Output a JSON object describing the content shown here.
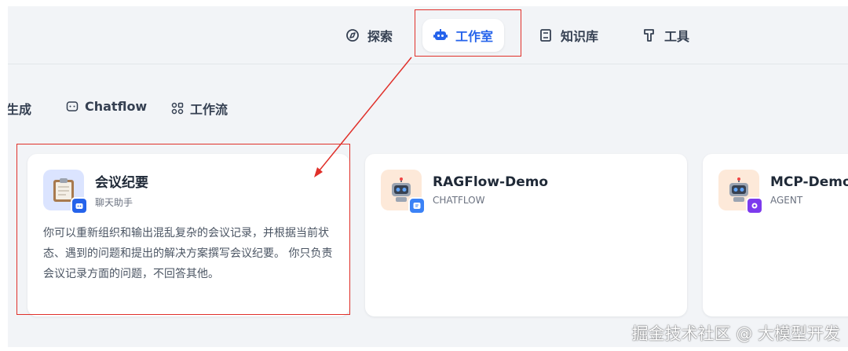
{
  "nav": {
    "items": [
      {
        "label": "探索",
        "icon": "compass-icon",
        "active": false
      },
      {
        "label": "工作室",
        "icon": "robot-icon",
        "active": true
      },
      {
        "label": "知识库",
        "icon": "book-icon",
        "active": false
      },
      {
        "label": "工具",
        "icon": "hammer-icon",
        "active": false
      }
    ]
  },
  "filter_tabs": [
    {
      "label": "生成",
      "icon": "sparkle-icon"
    },
    {
      "label": "Chatflow",
      "icon": "chat-icon"
    },
    {
      "label": "工作流",
      "icon": "workflow-icon"
    }
  ],
  "cards": [
    {
      "title": "会议纪要",
      "type": "聊天助手",
      "avatar_icon": "clipboard-icon",
      "badge_icon": "chatbot-badge-icon",
      "description": "你可以重新组织和输出混乱复杂的会议记录，并根据当前状态、遇到的问题和提出的解决方案撰写会议纪要。 你只负责会议记录方面的问题，不回答其他。"
    },
    {
      "title": "RAGFlow-Demo",
      "type": "CHATFLOW",
      "avatar_icon": "robot-icon",
      "badge_icon": "chatflow-badge-icon",
      "description": ""
    },
    {
      "title": "MCP-Demo",
      "type": "AGENT",
      "avatar_icon": "robot-icon",
      "badge_icon": "agent-badge-icon",
      "description": ""
    }
  ],
  "watermark": "掘金技术社区 @ 大模型开发",
  "colors": {
    "accent": "#2563eb",
    "annotation": "#e0302a",
    "background": "#f2f4f7"
  }
}
